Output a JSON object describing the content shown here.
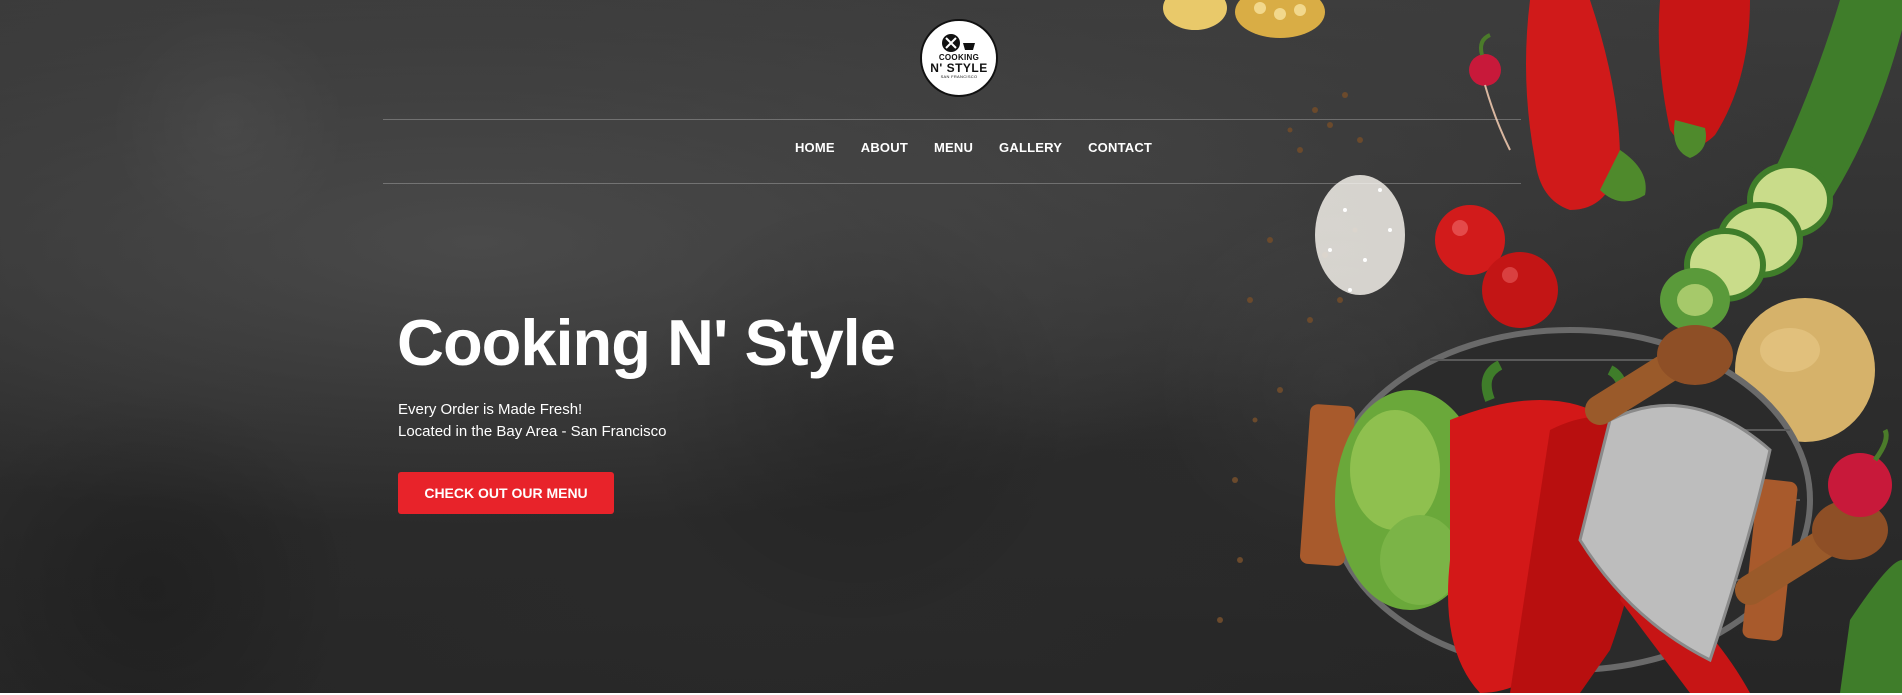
{
  "brand": {
    "logo_line1": "COOKING",
    "logo_line2": "N' STYLE",
    "logo_line3": "SAN FRANCISCO"
  },
  "nav": {
    "items": [
      {
        "label": "HOME"
      },
      {
        "label": "ABOUT"
      },
      {
        "label": "MENU"
      },
      {
        "label": "GALLERY"
      },
      {
        "label": "CONTACT"
      }
    ]
  },
  "hero": {
    "title": "Cooking N' Style",
    "subtitle_line1": "Every Order is Made Fresh!",
    "subtitle_line2": "Located in the Bay Area - San Francisco",
    "cta_label": "CHECK OUT OUR MENU"
  },
  "colors": {
    "accent": "#e8232a",
    "background": "#2f2f2f",
    "text": "#ffffff"
  }
}
